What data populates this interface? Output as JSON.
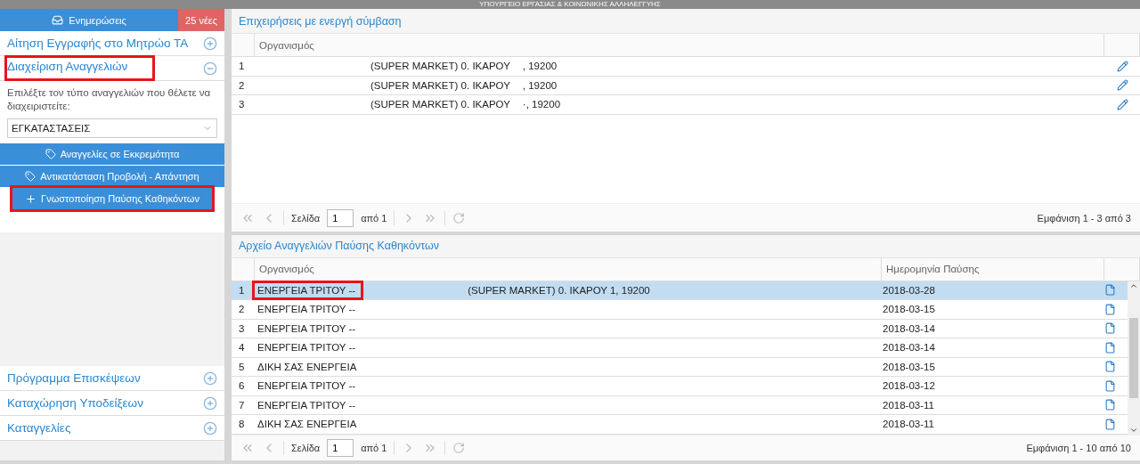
{
  "top_strip": {
    "title": "ΥΠΟΥΡΓΕΙΟ ΕΡΓΑΣΙΑΣ & ΚΟΙΝΩΝΙΚΗΣ ΑΛΛΗΛΕΓΓΥΗΣ"
  },
  "sidebar": {
    "notifications": {
      "label": "Ενημερώσεις",
      "badge": "25 νέες"
    },
    "sections_top": [
      {
        "label": "Αίτηση Εγγραφής στο Μητρώο ΤΑ",
        "expanded": false,
        "highlighted": false
      },
      {
        "label": "Διαχείριση Αναγγελιών",
        "expanded": true,
        "highlighted": true
      }
    ],
    "prompt": "Επιλέξτε τον τύπο αναγγελιών που θέλετε να διαχειριστείτε:",
    "type_select": {
      "value": "ΕΓΚΑΤΑΣΤΑΣΕΙΣ"
    },
    "actions": [
      {
        "kind": "tag",
        "label": "Αναγγελίες σε Εκκρεμότητα",
        "highlighted": false
      },
      {
        "kind": "tag",
        "label": "Αντικατάσταση Προβολή - Απάντηση",
        "highlighted": false
      },
      {
        "kind": "plus",
        "label": "Γνωστοποίηση Παύσης Καθηκόντων",
        "highlighted": true
      }
    ],
    "sections_bottom": [
      {
        "label": "Πρόγραμμα Επισκέψεων",
        "expanded": false,
        "highlighted": false
      },
      {
        "label": "Καταχώρηση Υποδείξεων",
        "expanded": false,
        "highlighted": false
      },
      {
        "label": "Καταγγελίες",
        "expanded": false,
        "highlighted": false
      }
    ]
  },
  "contracts_panel": {
    "title": "Επιχειρήσεις με ενεργή σύμβαση",
    "columns": [
      "Οργανισμός"
    ],
    "rows": [
      {
        "number": "1",
        "org_start": "(SUPER MARKET) 0. ΙΚΑΡΟΥ",
        "org_end": ", 19200"
      },
      {
        "number": "2",
        "org_start": "(SUPER MARKET) 0. ΙΚΑΡΟΥ",
        "org_end": ", 19200"
      },
      {
        "number": "3",
        "org_start": "(SUPER MARKET) 0. ΙΚΑΡΟΥ",
        "org_end": "·, 19200"
      }
    ],
    "pager": {
      "page_label": "Σελίδα",
      "page": "1",
      "of": "από 1",
      "summary": "Εμφάνιση 1 - 3 από 3"
    }
  },
  "archive_panel": {
    "title": "Αρχείο Αναγγελιών Παύσης Καθηκόντων",
    "columns": [
      "Οργανισμός",
      "Ημερομηνία Παύσης"
    ],
    "rows": [
      {
        "number": "1",
        "org_start": "ΕΝΕΡΓΕΙΑ ΤΡΙΤΟΥ --",
        "org_end": "(SUPER MARKET) 0. ΙΚΑΡΟΥ 1, 19200",
        "date": "2018-03-28",
        "selected": true,
        "highlighted": true
      },
      {
        "number": "2",
        "org_start": "ΕΝΕΡΓΕΙΑ ΤΡΙΤΟΥ --",
        "date": "2018-03-15",
        "selected": false,
        "highlighted": false
      },
      {
        "number": "3",
        "org_start": "ΕΝΕΡΓΕΙΑ ΤΡΙΤΟΥ --",
        "date": "2018-03-14",
        "selected": false,
        "highlighted": false
      },
      {
        "number": "4",
        "org_start": "ΕΝΕΡΓΕΙΑ ΤΡΙΤΟΥ --",
        "date": "2018-03-14",
        "selected": false,
        "highlighted": false
      },
      {
        "number": "5",
        "org_start": "ΔΙΚΗ ΣΑΣ ΕΝΕΡΓΕΙΑ",
        "date": "2018-03-15",
        "selected": false,
        "highlighted": false
      },
      {
        "number": "6",
        "org_start": "ΕΝΕΡΓΕΙΑ ΤΡΙΤΟΥ --",
        "date": "2018-03-12",
        "selected": false,
        "highlighted": false
      },
      {
        "number": "7",
        "org_start": "ΕΝΕΡΓΕΙΑ ΤΡΙΤΟΥ --",
        "date": "2018-03-11",
        "selected": false,
        "highlighted": false
      },
      {
        "number": "8",
        "org_start": "ΔΙΚΗ ΣΑΣ ΕΝΕΡΓΕΙΑ",
        "date": "2018-03-11",
        "selected": false,
        "highlighted": false
      }
    ],
    "pager": {
      "page_label": "Σελίδα",
      "page": "1",
      "of": "από 1",
      "summary": "Εμφάνιση 1 - 10 από 10"
    }
  }
}
